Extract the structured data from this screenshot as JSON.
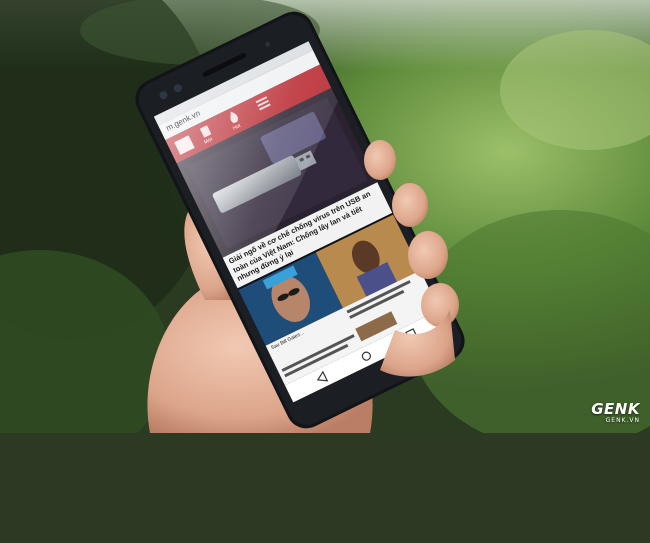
{
  "photo": {
    "subject": "hand holding a smartphone displaying a news website",
    "colors": {
      "foliage_dark": "#1f2d1a",
      "foliage_light": "#8fb45a",
      "skin": "#e8b9a0",
      "phone_body": "#121418",
      "site_red": "#b8262e"
    }
  },
  "screen": {
    "url": "m.genk.vn",
    "menu_items": [
      "Mới",
      "Hot"
    ],
    "headline": "Giải ngố về cơ chế chống virus trên USB an toàn của Việt Nam: Chống lây lan và tiết nhưng đừng ỷ lại",
    "caption": "Sau Bill Gates...",
    "nav_icons": [
      "back-icon",
      "home-icon",
      "recents-icon"
    ]
  },
  "watermark": {
    "brand": "GENK",
    "site": "GENK.VN"
  }
}
